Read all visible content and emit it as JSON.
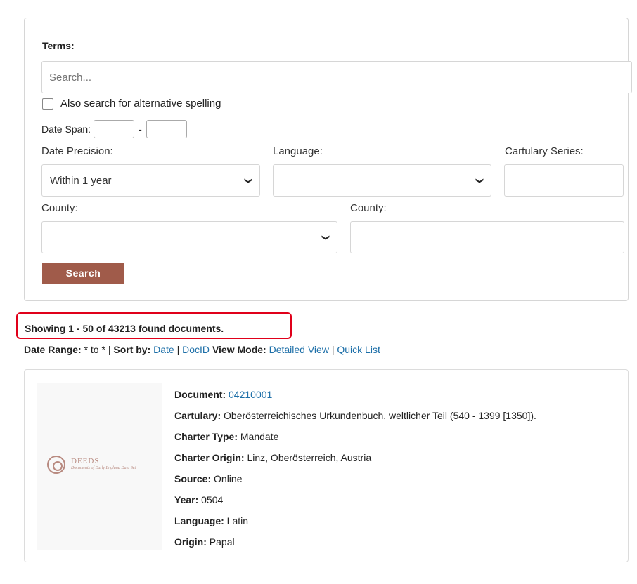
{
  "search": {
    "terms_label": "Terms:",
    "terms_placeholder": "Search...",
    "alt_spelling_label": "Also search for alternative spelling",
    "date_span_label": "Date Span:",
    "date_span_separator": "-",
    "date_precision_label": "Date Precision:",
    "date_precision_value": "Within 1 year",
    "language_label": "Language:",
    "language_value": "",
    "cartulary_series_label": "Cartulary Series:",
    "county_label_1": "County:",
    "county_label_2": "County:",
    "search_button": "Search"
  },
  "results": {
    "summary": "Showing 1 - 50 of 43213 found documents.",
    "date_range_label": "Date Range:",
    "date_range_value": " * to * | ",
    "sort_by_label": "Sort by:",
    "sort_date": "Date",
    "sort_separator": " | ",
    "sort_docid": "DocID",
    "view_mode_label": "View Mode:",
    "view_detailed": "Detailed View",
    "view_separator": " | ",
    "view_quick": "Quick List"
  },
  "document": {
    "logo_title": "DEEDS",
    "logo_subtitle": "Documents of Early England Data Set",
    "fields": [
      {
        "label": "Document:",
        "value": "04210001",
        "link": true
      },
      {
        "label": "Cartulary:",
        "value": "Oberösterreichisches Urkundenbuch, weltlicher Teil (540 - 1399 [1350]).",
        "link": false
      },
      {
        "label": "Charter Type:",
        "value": "Mandate",
        "link": false
      },
      {
        "label": "Charter Origin:",
        "value": "Linz, Oberösterreich, Austria",
        "link": false
      },
      {
        "label": "Source:",
        "value": "Online",
        "link": false
      },
      {
        "label": "Year:",
        "value": "0504",
        "link": false
      },
      {
        "label": "Language:",
        "value": "Latin",
        "link": false
      },
      {
        "label": "Origin:",
        "value": "Papal",
        "link": false
      }
    ]
  },
  "colors": {
    "button": "#a05b4a",
    "link": "#1d6fa8",
    "highlight": "#e0001a"
  }
}
